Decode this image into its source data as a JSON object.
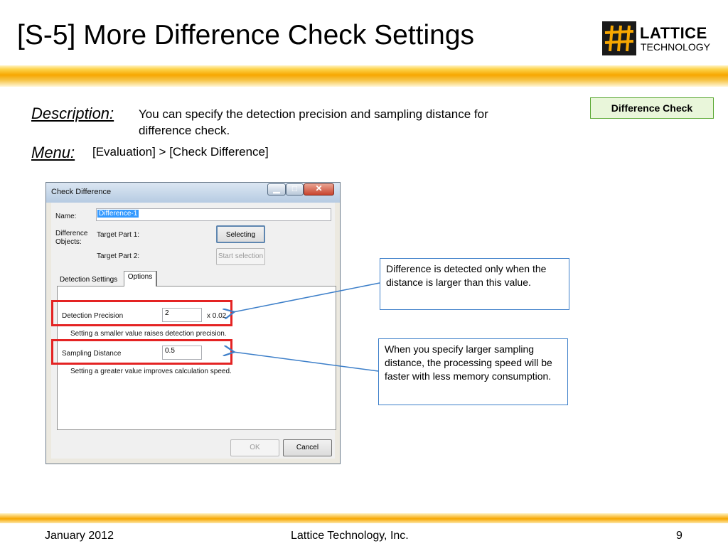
{
  "slide": {
    "title": "[S-5] More Difference Check Settings",
    "logo": {
      "word1": "LATTICE",
      "word2": "TECHNOLOGY"
    },
    "tag": "Difference Check"
  },
  "description": {
    "label": "Description:",
    "text_line1": "You can specify the detection precision and sampling distance for",
    "text_line2": "difference check."
  },
  "menu": {
    "label": "Menu:",
    "path": "[Evaluation] > [Check Difference]"
  },
  "dialog": {
    "title": "Check Difference",
    "name_label": "Name:",
    "name_value": "Difference-1",
    "objects_label_line1": "Difference",
    "objects_label_line2": "Objects:",
    "target1_label": "Target Part 1:",
    "target1_button": "Selecting",
    "target2_label": "Target Part 2:",
    "target2_button": "Start selection",
    "tabs": [
      "Detection Settings",
      "Options"
    ],
    "detection_precision_label": "Detection Precision",
    "detection_precision_value": "2",
    "detection_precision_unit": "x 0.02",
    "detection_precision_hint": "Setting a smaller value raises detection precision.",
    "sampling_distance_label": "Sampling Distance",
    "sampling_distance_value": "0.5",
    "sampling_distance_hint": "Setting a greater value improves calculation speed.",
    "ok_button": "OK",
    "cancel_button": "Cancel"
  },
  "callouts": {
    "precision": "Difference is detected only when the distance is larger than this value.",
    "sampling": "When you specify larger sampling distance, the processing speed will be faster with less memory consumption."
  },
  "footer": {
    "date": "January 2012",
    "company": "Lattice Technology, Inc.",
    "page": "9"
  },
  "colors": {
    "accent_orange": "#f7a700",
    "highlight_red": "#e42323",
    "callout_blue": "#3d7fc9",
    "tag_green": "#5aa832"
  }
}
